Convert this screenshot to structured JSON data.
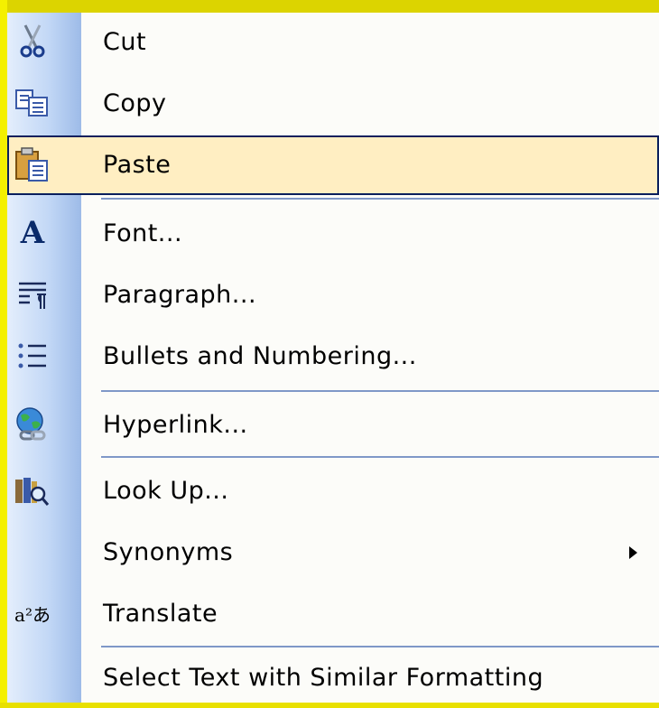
{
  "menu": {
    "items": [
      {
        "label": "Cut",
        "icon": "scissors-icon"
      },
      {
        "label": "Copy",
        "icon": "copy-icon"
      },
      {
        "label": "Paste",
        "icon": "paste-icon",
        "highlighted": true
      },
      {
        "label": "Font...",
        "icon": "font-icon",
        "icon_glyph": "A"
      },
      {
        "label": "Paragraph...",
        "icon": "paragraph-icon"
      },
      {
        "label": "Bullets and Numbering...",
        "icon": "bullets-icon"
      },
      {
        "label": "Hyperlink...",
        "icon": "hyperlink-globe-icon"
      },
      {
        "label": "Look Up...",
        "icon": "lookup-icon"
      },
      {
        "label": "Synonyms",
        "has_submenu": true
      },
      {
        "label": "Translate",
        "icon": "translate-icon",
        "icon_glyph": "a²あ"
      },
      {
        "label": "Select Text with Similar Formatting"
      }
    ]
  },
  "colors": {
    "highlight_bg": "#ffeec2",
    "highlight_border": "#0a1f5c",
    "separator": "#7f98c8",
    "gutter_dark": "#9dbbe8",
    "frame": "#e8e000"
  }
}
